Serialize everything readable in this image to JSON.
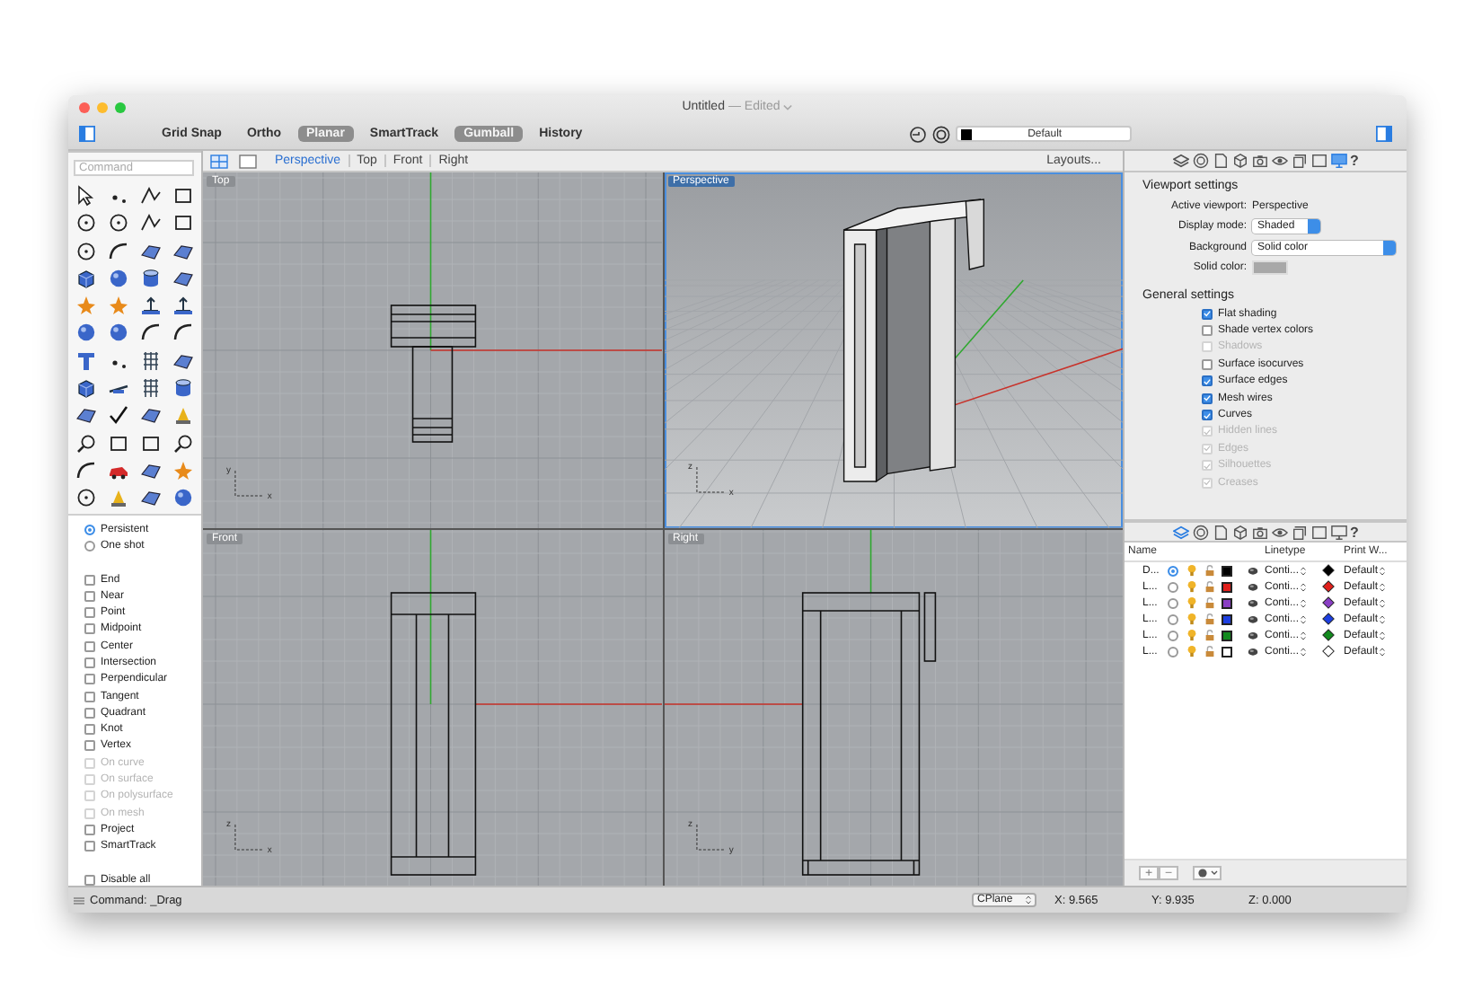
{
  "window": {
    "title": "Untitled",
    "subtitle": "— Edited"
  },
  "toolbar": {
    "toggles": [
      {
        "label": "Grid Snap",
        "on": false
      },
      {
        "label": "Ortho",
        "on": false
      },
      {
        "label": "Planar",
        "on": true
      },
      {
        "label": "SmartTrack",
        "on": false
      },
      {
        "label": "Gumball",
        "on": true
      },
      {
        "label": "History",
        "on": false
      }
    ],
    "layer": {
      "name": "Default",
      "color": "#000000"
    }
  },
  "view_tabs": [
    {
      "label": "Perspective",
      "selected": true
    },
    {
      "label": "Top",
      "selected": false
    },
    {
      "label": "Front",
      "selected": false
    },
    {
      "label": "Right",
      "selected": false
    }
  ],
  "layouts_button": "Layouts...",
  "command_field": {
    "placeholder": "Command"
  },
  "osnap": {
    "modes": [
      {
        "label": "Persistent",
        "selected": true
      },
      {
        "label": "One shot",
        "selected": false
      }
    ],
    "snaps": [
      {
        "label": "End",
        "checked": false,
        "disabled": false
      },
      {
        "label": "Near",
        "checked": false,
        "disabled": false
      },
      {
        "label": "Point",
        "checked": false,
        "disabled": false
      },
      {
        "label": "Midpoint",
        "checked": false,
        "disabled": false
      },
      {
        "label": "Center",
        "checked": false,
        "disabled": false
      },
      {
        "label": "Intersection",
        "checked": false,
        "disabled": false
      },
      {
        "label": "Perpendicular",
        "checked": false,
        "disabled": false
      },
      {
        "label": "Tangent",
        "checked": false,
        "disabled": false
      },
      {
        "label": "Quadrant",
        "checked": false,
        "disabled": false
      },
      {
        "label": "Knot",
        "checked": false,
        "disabled": false
      },
      {
        "label": "Vertex",
        "checked": false,
        "disabled": false
      },
      {
        "label": "On curve",
        "checked": false,
        "disabled": true
      },
      {
        "label": "On surface",
        "checked": false,
        "disabled": true
      },
      {
        "label": "On polysurface",
        "checked": false,
        "disabled": true
      },
      {
        "label": "On mesh",
        "checked": false,
        "disabled": true
      },
      {
        "label": "Project",
        "checked": false,
        "disabled": false
      },
      {
        "label": "SmartTrack",
        "checked": false,
        "disabled": false
      }
    ],
    "disable_all": {
      "label": "Disable all",
      "checked": false
    }
  },
  "viewports": [
    {
      "title": "Top",
      "kind": "top",
      "selected": false,
      "axis_labels": [
        "y",
        "x"
      ]
    },
    {
      "title": "Perspective",
      "kind": "perspective",
      "selected": true,
      "axis_labels": [
        "z",
        "x"
      ]
    },
    {
      "title": "Front",
      "kind": "front",
      "selected": false,
      "axis_labels": [
        "z",
        "x"
      ]
    },
    {
      "title": "Right",
      "kind": "right",
      "selected": false,
      "axis_labels": [
        "z",
        "y"
      ]
    }
  ],
  "inspector_tabs": [
    {
      "kind": "layers",
      "selected": false
    },
    {
      "kind": "materials",
      "selected": false
    },
    {
      "kind": "document",
      "selected": false
    },
    {
      "kind": "object",
      "selected": false
    },
    {
      "kind": "camera",
      "selected": false
    },
    {
      "kind": "eye",
      "selected": false
    },
    {
      "kind": "display",
      "selected": false
    },
    {
      "kind": "frame",
      "selected": false
    },
    {
      "kind": "monitor",
      "selected": true
    },
    {
      "kind": "help",
      "label": "?",
      "selected": false
    }
  ],
  "viewport_settings": {
    "heading": "Viewport settings",
    "fields": [
      {
        "kind": "text",
        "label": "Active viewport:",
        "value": "Perspective"
      },
      {
        "kind": "select",
        "label": "Display mode:",
        "value": "Shaded"
      },
      {
        "kind": "wide-select",
        "label": "Background",
        "value": "Solid color"
      },
      {
        "kind": "swatch",
        "label": "Solid color:",
        "color": "#a8a8a8"
      }
    ],
    "general_heading": "General settings",
    "options": [
      {
        "label": "Flat shading",
        "checked": true,
        "disabled": false
      },
      {
        "label": "Shade vertex colors",
        "checked": false,
        "disabled": false
      },
      {
        "label": "Shadows",
        "checked": false,
        "disabled": true
      },
      {
        "label": "Surface isocurves",
        "checked": false,
        "disabled": false
      },
      {
        "label": "Surface edges",
        "checked": true,
        "disabled": false
      },
      {
        "label": "Mesh wires",
        "checked": true,
        "disabled": false
      },
      {
        "label": "Curves",
        "checked": true,
        "disabled": false
      },
      {
        "label": "Hidden lines",
        "checked": true,
        "disabled": true
      },
      {
        "label": "Edges",
        "checked": true,
        "disabled": true
      },
      {
        "label": "Silhouettes",
        "checked": true,
        "disabled": true
      },
      {
        "label": "Creases",
        "checked": true,
        "disabled": true
      }
    ]
  },
  "layer_tabs": [
    {
      "kind": "layers",
      "selected": true
    },
    {
      "kind": "materials",
      "selected": false
    },
    {
      "kind": "document",
      "selected": false
    },
    {
      "kind": "object",
      "selected": false
    },
    {
      "kind": "camera",
      "selected": false
    },
    {
      "kind": "eye",
      "selected": false
    },
    {
      "kind": "display",
      "selected": false
    },
    {
      "kind": "frame",
      "selected": false
    },
    {
      "kind": "monitor",
      "selected": false
    },
    {
      "kind": "help",
      "label": "?",
      "selected": false
    }
  ],
  "layers": {
    "columns": {
      "name": "Name",
      "linetype": "Linetype",
      "print_width": "Print W..."
    },
    "rows": [
      {
        "name": "D...",
        "current": true,
        "color": "#000000",
        "linetype": "Conti...",
        "print_width": "Default"
      },
      {
        "name": "L...",
        "current": false,
        "color": "#e0201c",
        "linetype": "Conti...",
        "print_width": "Default"
      },
      {
        "name": "L...",
        "current": false,
        "color": "#8a3fc4",
        "linetype": "Conti...",
        "print_width": "Default"
      },
      {
        "name": "L...",
        "current": false,
        "color": "#1d3fe0",
        "linetype": "Conti...",
        "print_width": "Default"
      },
      {
        "name": "L...",
        "current": false,
        "color": "#138a1e",
        "linetype": "Conti...",
        "print_width": "Default"
      },
      {
        "name": "L...",
        "current": false,
        "color": "#ffffff",
        "linetype": "Conti...",
        "print_width": "Default"
      }
    ],
    "add_button": "+",
    "remove_button": "−"
  },
  "status_bar": {
    "command": "Command: _Drag",
    "cplane": "CPlane",
    "x": "X: 9.565",
    "y": "Y: 9.935",
    "z": "Z: 0.000"
  }
}
